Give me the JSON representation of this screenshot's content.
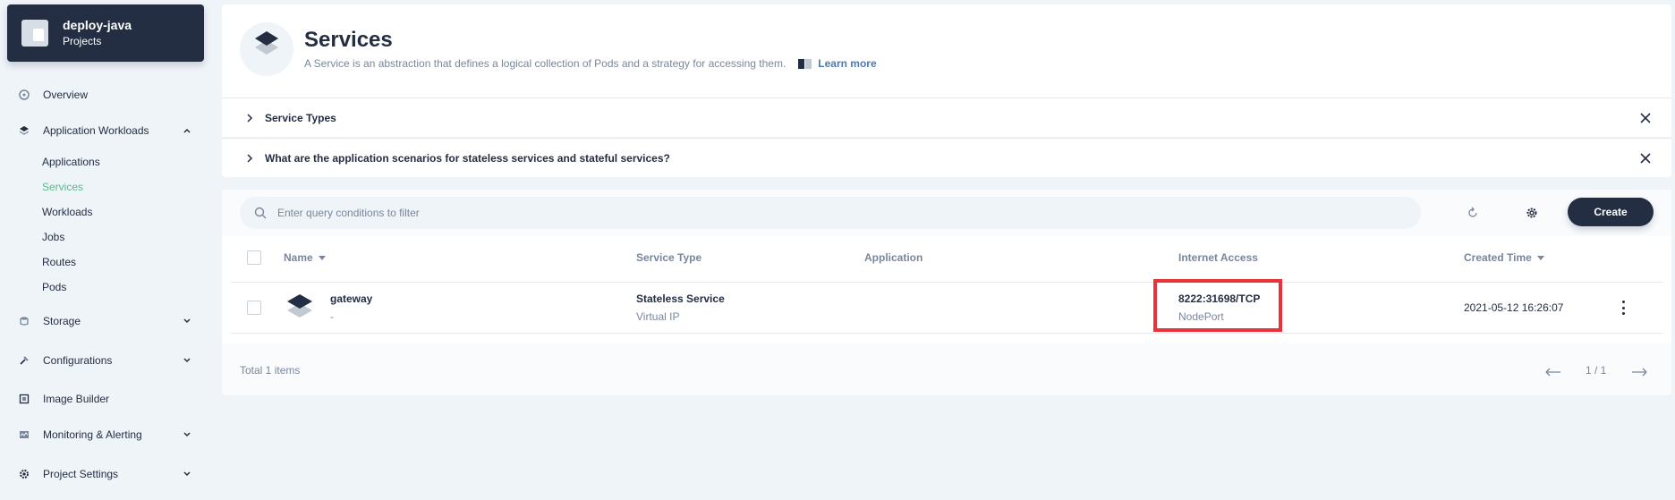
{
  "project": {
    "name": "deploy-java",
    "subtitle": "Projects"
  },
  "sidebar": {
    "overview": "Overview",
    "workloads": {
      "label": "Application Workloads",
      "items": [
        "Applications",
        "Services",
        "Workloads",
        "Jobs",
        "Routes",
        "Pods"
      ],
      "active": "Services"
    },
    "storage": "Storage",
    "configurations": "Configurations",
    "image_builder": "Image Builder",
    "monitoring": "Monitoring & Alerting",
    "project_settings": "Project Settings"
  },
  "header": {
    "title": "Services",
    "description": "A Service is an abstraction that defines a logical collection of Pods and a strategy for accessing them.",
    "learn_more": "Learn more"
  },
  "collapsibles": [
    "Service Types",
    "What are the application scenarios for stateless services and stateful services?"
  ],
  "toolbar": {
    "search_placeholder": "Enter query conditions to filter",
    "create_label": "Create"
  },
  "table": {
    "columns": {
      "name": "Name",
      "service_type": "Service Type",
      "application": "Application",
      "internet_access": "Internet Access",
      "created_time": "Created Time"
    },
    "rows": [
      {
        "name": "gateway",
        "name_sub": "-",
        "service_type": "Stateless Service",
        "service_type_sub": "Virtual IP",
        "application": "",
        "internet_access": "8222:31698/TCP",
        "internet_access_sub": "NodePort",
        "created_time": "2021-05-12 16:26:07"
      }
    ]
  },
  "footer": {
    "total": "Total 1 items",
    "page": "1 / 1"
  },
  "colors": {
    "active_green": "#55bc8a",
    "dark": "#242e42",
    "highlight_red": "#e8333a"
  }
}
